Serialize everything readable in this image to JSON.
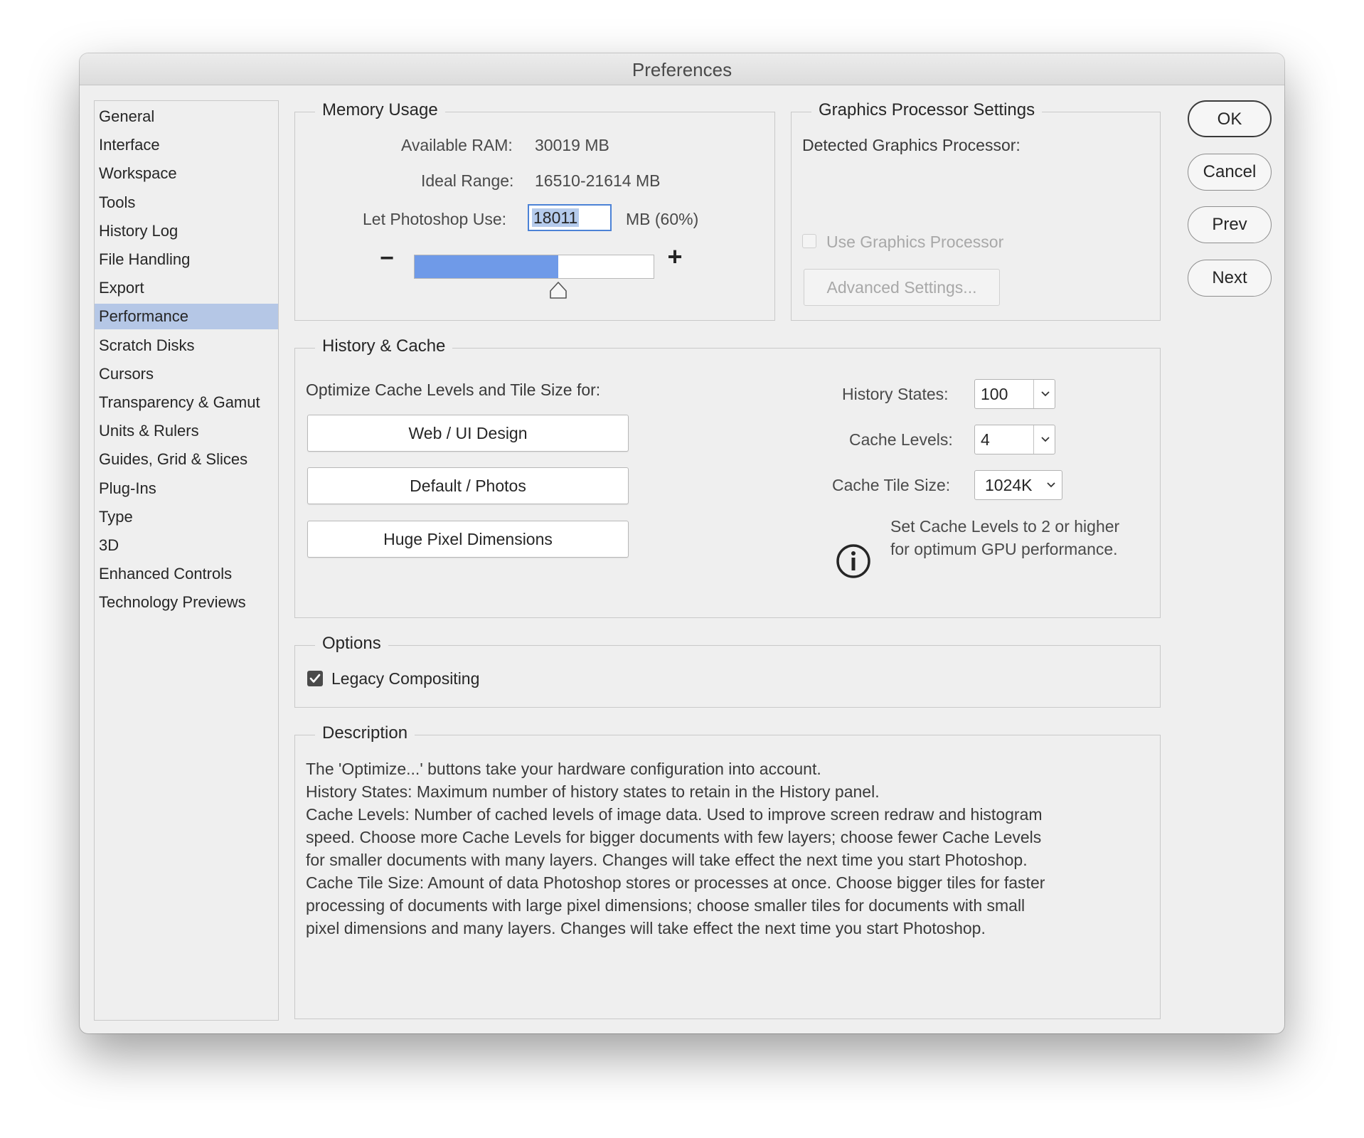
{
  "window": {
    "title": "Preferences"
  },
  "sidebar": {
    "items": [
      {
        "label": "General"
      },
      {
        "label": "Interface"
      },
      {
        "label": "Workspace"
      },
      {
        "label": "Tools"
      },
      {
        "label": "History Log"
      },
      {
        "label": "File Handling"
      },
      {
        "label": "Export"
      },
      {
        "label": "Performance",
        "selected": true
      },
      {
        "label": "Scratch Disks"
      },
      {
        "label": "Cursors"
      },
      {
        "label": "Transparency & Gamut"
      },
      {
        "label": "Units & Rulers"
      },
      {
        "label": "Guides, Grid & Slices"
      },
      {
        "label": "Plug-Ins"
      },
      {
        "label": "Type"
      },
      {
        "label": "3D"
      },
      {
        "label": "Enhanced Controls"
      },
      {
        "label": "Technology Previews"
      }
    ]
  },
  "memory": {
    "title": "Memory Usage",
    "available_label": "Available RAM:",
    "available_value": "30019 MB",
    "ideal_label": "Ideal Range:",
    "ideal_value": "16510-21614 MB",
    "use_label": "Let Photoshop Use:",
    "use_value": "18011",
    "use_suffix": "MB (60%)",
    "slider_fraction": 0.6,
    "minus_symbol": "−",
    "plus_symbol": "+"
  },
  "gpu": {
    "title": "Graphics Processor Settings",
    "detected_label": "Detected Graphics Processor:",
    "use_gpu_label": "Use Graphics Processor",
    "use_gpu_checked": false,
    "advanced_label": "Advanced Settings..."
  },
  "history_cache": {
    "title": "History & Cache",
    "optimize_label": "Optimize Cache Levels and Tile Size for:",
    "buttons": [
      "Web / UI Design",
      "Default / Photos",
      "Huge Pixel Dimensions"
    ],
    "history_states_label": "History States:",
    "history_states_value": "100",
    "cache_levels_label": "Cache Levels:",
    "cache_levels_value": "4",
    "cache_tile_label": "Cache Tile Size:",
    "cache_tile_value": "1024K",
    "info_line1": "Set Cache Levels to 2 or higher",
    "info_line2": "for optimum GPU performance."
  },
  "options": {
    "title": "Options",
    "legacy_label": "Legacy Compositing",
    "legacy_checked": true
  },
  "description": {
    "title": "Description",
    "text": "The 'Optimize...' buttons take your hardware configuration into account.\nHistory States: Maximum number of history states to retain in the History panel.\nCache Levels: Number of cached levels of image data.  Used to improve screen redraw and histogram\nspeed.  Choose more Cache Levels for bigger documents with few layers; choose fewer Cache Levels\nfor smaller documents with many layers. Changes will take effect the next time you start Photoshop.\nCache Tile Size: Amount of data Photoshop stores or processes at once. Choose bigger tiles for faster\nprocessing of documents with large pixel dimensions; choose smaller tiles for documents with small\npixel dimensions and many layers. Changes will take effect the next time you start Photoshop."
  },
  "actions": {
    "ok": "OK",
    "cancel": "Cancel",
    "prev": "Prev",
    "next": "Next"
  },
  "colors": {
    "accent": "#4b82d6",
    "selection": "#b5c7e6",
    "slider_fill": "#6f9ae8"
  }
}
